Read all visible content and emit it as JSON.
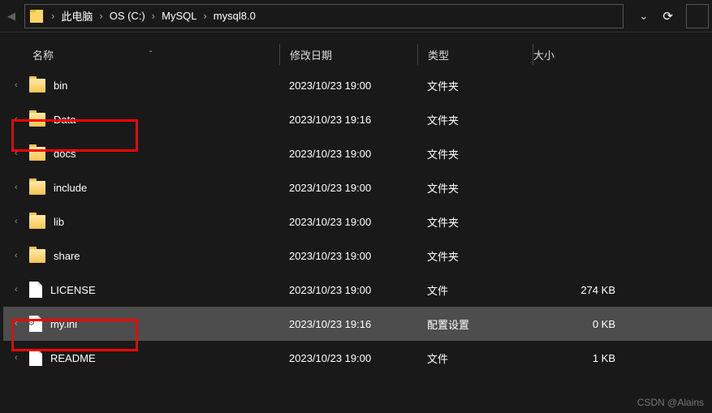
{
  "breadcrumb": {
    "items": [
      "此电脑",
      "OS (C:)",
      "MySQL",
      "mysql8.0"
    ]
  },
  "columns": {
    "name": "名称",
    "date": "修改日期",
    "type": "类型",
    "size": "大小"
  },
  "rows": [
    {
      "name": "bin",
      "date": "2023/10/23 19:00",
      "type": "文件夹",
      "size": "",
      "icon": "folder",
      "selected": false
    },
    {
      "name": "Data",
      "date": "2023/10/23 19:16",
      "type": "文件夹",
      "size": "",
      "icon": "folder",
      "selected": false
    },
    {
      "name": "docs",
      "date": "2023/10/23 19:00",
      "type": "文件夹",
      "size": "",
      "icon": "folder",
      "selected": false
    },
    {
      "name": "include",
      "date": "2023/10/23 19:00",
      "type": "文件夹",
      "size": "",
      "icon": "folder",
      "selected": false
    },
    {
      "name": "lib",
      "date": "2023/10/23 19:00",
      "type": "文件夹",
      "size": "",
      "icon": "folder",
      "selected": false
    },
    {
      "name": "share",
      "date": "2023/10/23 19:00",
      "type": "文件夹",
      "size": "",
      "icon": "folder",
      "selected": false
    },
    {
      "name": "LICENSE",
      "date": "2023/10/23 19:00",
      "type": "文件",
      "size": "274 KB",
      "icon": "file",
      "selected": false
    },
    {
      "name": "my.ini",
      "date": "2023/10/23 19:16",
      "type": "配置设置",
      "size": "0 KB",
      "icon": "config",
      "selected": true
    },
    {
      "name": "README",
      "date": "2023/10/23 19:00",
      "type": "文件",
      "size": "1 KB",
      "icon": "file",
      "selected": false
    }
  ],
  "watermark": "CSDN @Alains"
}
